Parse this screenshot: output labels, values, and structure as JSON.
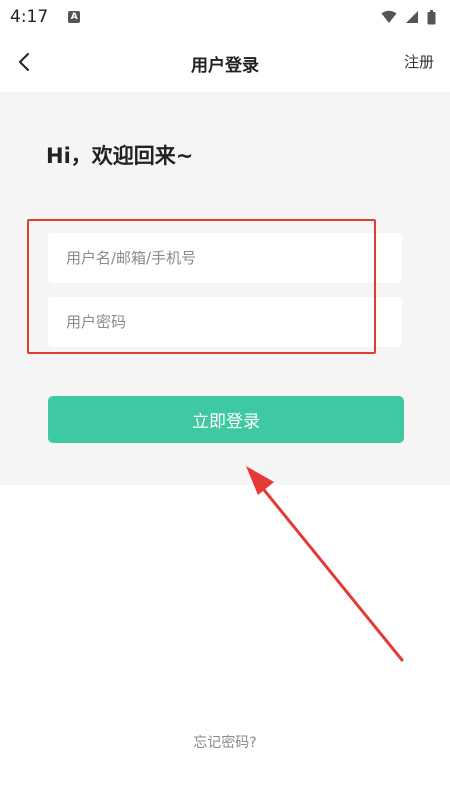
{
  "status_bar": {
    "time": "4:17",
    "app_badge": "A",
    "icons": [
      "wifi-icon",
      "cell-signal-icon",
      "battery-icon"
    ]
  },
  "header": {
    "back_icon": "chevron-left-icon",
    "title": "用户登录",
    "register_label": "注册"
  },
  "login": {
    "greeting": "Hi，欢迎回来~",
    "username_placeholder": "用户名/邮箱/手机号",
    "password_placeholder": "用户密码",
    "submit_label": "立即登录"
  },
  "footer": {
    "forgot_password": "忘记密码?"
  },
  "colors": {
    "accent": "#3ec9a2",
    "panel_bg": "#f5f5f5",
    "annotation": "#e53935"
  }
}
